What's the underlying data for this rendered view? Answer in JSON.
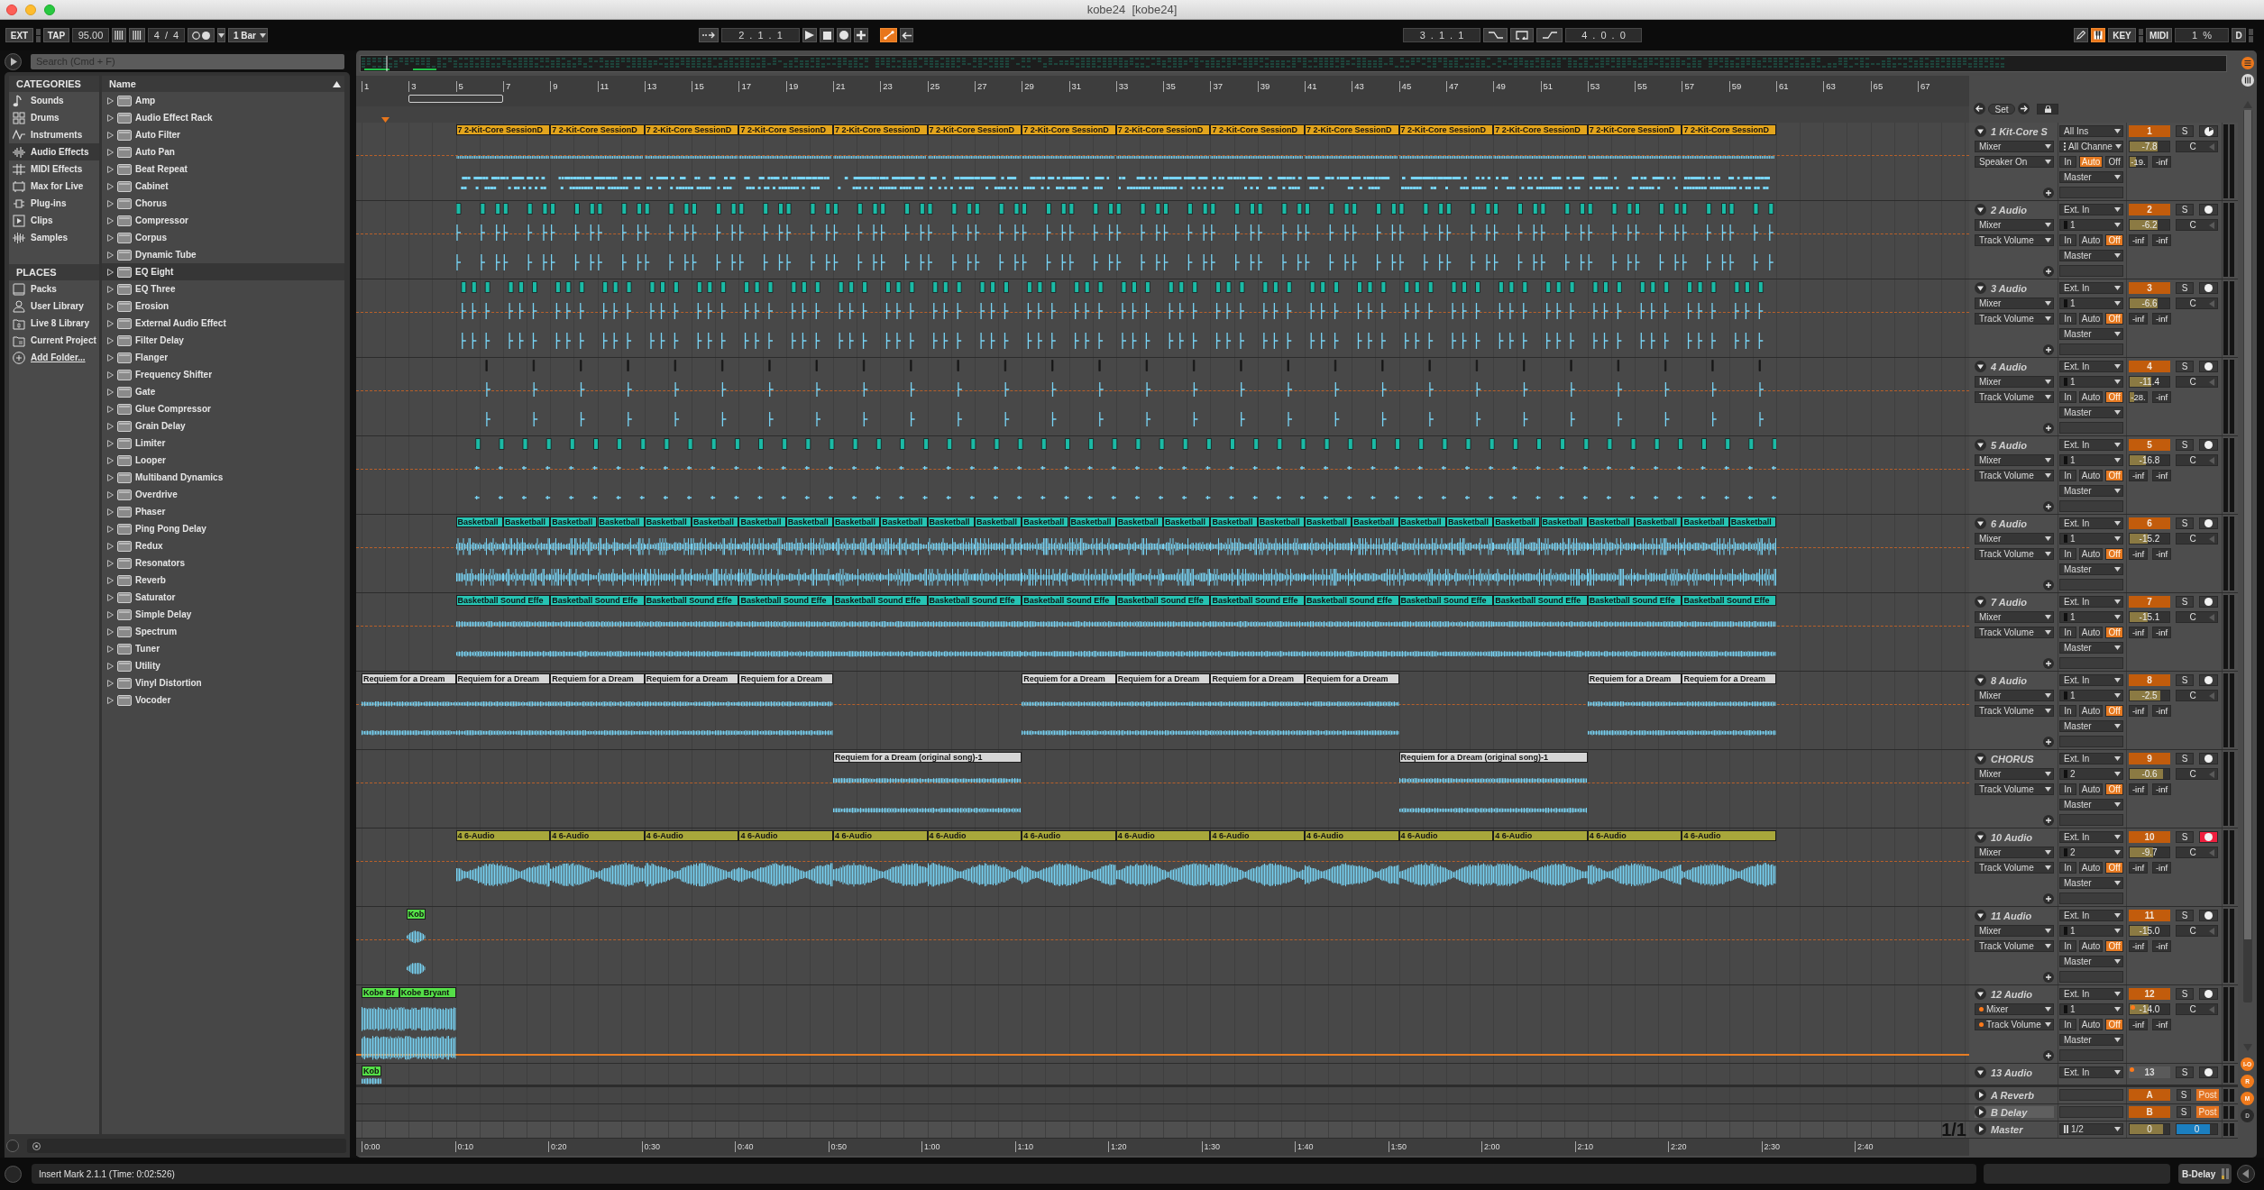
{
  "window": {
    "title": "kobe24  [kobe24]"
  },
  "control_bar": {
    "ext": "EXT",
    "tap": "TAP",
    "tempo": "95.00",
    "time_signature": "4 / 4",
    "metronome_on": false,
    "quantization": "1 Bar",
    "follow_on": false,
    "position": "2 . 1 . 1",
    "transport": [
      {
        "kind": "play",
        "on": false
      },
      {
        "kind": "stop",
        "on": false
      },
      {
        "kind": "record",
        "on": false
      },
      {
        "kind": "overdub",
        "on": false
      },
      {
        "kind": "automation_arm",
        "on": true
      },
      {
        "kind": "back_to_arrangement",
        "on": false
      }
    ],
    "loop_start": "3 . 1 . 1",
    "loop_switches": [
      {
        "kind": "punch_in",
        "on": false
      },
      {
        "kind": "loop",
        "on": false
      },
      {
        "kind": "punch_out",
        "on": false
      }
    ],
    "loop_length": "4 . 0 . 0",
    "draw_mode_on": false,
    "computer_keyboard_on": true,
    "key_map": "KEY",
    "midi_map": "MIDI",
    "cpu_load": "1 %",
    "disk_overload": "D"
  },
  "browser": {
    "search": {
      "placeholder": "Search (Cmd + F)"
    },
    "categories_heading": "CATEGORIES",
    "categories": [
      {
        "label": "Sounds",
        "selected": false
      },
      {
        "label": "Drums",
        "selected": false
      },
      {
        "label": "Instruments",
        "selected": false
      },
      {
        "label": "Audio Effects",
        "selected": true
      },
      {
        "label": "MIDI Effects",
        "selected": false
      },
      {
        "label": "Max for Live",
        "selected": false
      },
      {
        "label": "Plug-ins",
        "selected": false
      },
      {
        "label": "Clips",
        "selected": false
      },
      {
        "label": "Samples",
        "selected": false
      }
    ],
    "places_heading": "PLACES",
    "places": [
      {
        "label": "Packs",
        "selected": false
      },
      {
        "label": "User Library",
        "selected": false
      },
      {
        "label": "Live 8 Library",
        "selected": false
      },
      {
        "label": "Current Project",
        "selected": false
      }
    ],
    "add_folder": "Add Folder...",
    "name_column": "Name",
    "items": [
      {
        "label": "Amp",
        "expanded": false,
        "selected": false
      },
      {
        "label": "Audio Effect Rack",
        "expanded": false,
        "selected": false
      },
      {
        "label": "Auto Filter",
        "expanded": false,
        "selected": false
      },
      {
        "label": "Auto Pan",
        "expanded": false,
        "selected": false
      },
      {
        "label": "Beat Repeat",
        "expanded": false,
        "selected": false
      },
      {
        "label": "Cabinet",
        "expanded": false,
        "selected": false
      },
      {
        "label": "Chorus",
        "expanded": false,
        "selected": false
      },
      {
        "label": "Compressor",
        "expanded": false,
        "selected": false
      },
      {
        "label": "Corpus",
        "expanded": false,
        "selected": false
      },
      {
        "label": "Dynamic Tube",
        "expanded": false,
        "selected": false
      },
      {
        "label": "EQ Eight",
        "expanded": false,
        "selected": true
      },
      {
        "label": "EQ Three",
        "expanded": false,
        "selected": false
      },
      {
        "label": "Erosion",
        "expanded": false,
        "selected": false
      },
      {
        "label": "External Audio Effect",
        "expanded": false,
        "selected": false
      },
      {
        "label": "Filter Delay",
        "expanded": false,
        "selected": false
      },
      {
        "label": "Flanger",
        "expanded": false,
        "selected": false
      },
      {
        "label": "Frequency Shifter",
        "expanded": false,
        "selected": false
      },
      {
        "label": "Gate",
        "expanded": false,
        "selected": false
      },
      {
        "label": "Glue Compressor",
        "expanded": false,
        "selected": false
      },
      {
        "label": "Grain Delay",
        "expanded": false,
        "selected": false
      },
      {
        "label": "Limiter",
        "expanded": false,
        "selected": false
      },
      {
        "label": "Looper",
        "expanded": false,
        "selected": false
      },
      {
        "label": "Multiband Dynamics",
        "expanded": false,
        "selected": false
      },
      {
        "label": "Overdrive",
        "expanded": false,
        "selected": false
      },
      {
        "label": "Phaser",
        "expanded": false,
        "selected": false
      },
      {
        "label": "Ping Pong Delay",
        "expanded": false,
        "selected": false
      },
      {
        "label": "Redux",
        "expanded": false,
        "selected": false
      },
      {
        "label": "Resonators",
        "expanded": false,
        "selected": false
      },
      {
        "label": "Reverb",
        "expanded": false,
        "selected": false
      },
      {
        "label": "Saturator",
        "expanded": false,
        "selected": false
      },
      {
        "label": "Simple Delay",
        "expanded": false,
        "selected": false
      },
      {
        "label": "Spectrum",
        "expanded": false,
        "selected": false
      },
      {
        "label": "Tuner",
        "expanded": false,
        "selected": false
      },
      {
        "label": "Utility",
        "expanded": false,
        "selected": false
      },
      {
        "label": "Vinyl Distortion",
        "expanded": false,
        "selected": false
      },
      {
        "label": "Vocoder",
        "expanded": false,
        "selected": false
      }
    ]
  },
  "arrangement": {
    "bar_ruler": [
      "1",
      "3",
      "5",
      "7",
      "9",
      "11",
      "13",
      "15",
      "17",
      "19",
      "21",
      "23",
      "25",
      "27",
      "29",
      "31",
      "33",
      "35",
      "37",
      "39",
      "41",
      "43",
      "45",
      "47",
      "49",
      "51",
      "53",
      "55",
      "57",
      "59",
      "61",
      "63",
      "65",
      "67"
    ],
    "locators": {
      "set": "Set"
    },
    "tracks": [
      {
        "name": "1 Kit-Core S",
        "kind": "midi",
        "expanded": true,
        "selected": false,
        "color": "#e3a51d",
        "clips": [
          {
            "name": "7 2-Kit-Core SessionD"
          },
          {
            "name": "7 2-Kit-Core SessionD"
          },
          {
            "name": "7 2-Kit-Core SessionD"
          },
          {
            "name": "7 2-Kit-Core SessionD"
          },
          {
            "name": "7 2-Kit-Core SessionD"
          },
          {
            "name": "7 2-Kit-Core SessionD"
          },
          {
            "name": "7 2-Kit-Core SessionD"
          },
          {
            "name": "7 2-Kit-Core SessionD"
          },
          {
            "name": "7 2-Kit-Core SessionD"
          },
          {
            "name": "7 2-Kit-Core SessionD"
          },
          {
            "name": "7 2-Kit-Core SessionD"
          },
          {
            "name": "7 2-Kit-Core SessionD"
          },
          {
            "name": "7 2-Kit-Core SessionD"
          },
          {
            "name": "7 2-Kit-Core SessionD"
          }
        ],
        "device_chooser": "Mixer",
        "control_chooser": "Speaker On",
        "automation": false,
        "input_type": "All Ins",
        "input_channel": "All Channe",
        "monitor": [
          {
            "label": "In",
            "selected": false
          },
          {
            "label": "Auto",
            "selected": true
          },
          {
            "label": "Off",
            "selected": false
          }
        ],
        "output": "Master",
        "number": "1",
        "active": true,
        "solo": "S",
        "armed": false,
        "volume": {
          "reading": "-7.8",
          "level": 0.7
        },
        "pan": "C",
        "peak": [
          {
            "reading": "-19.",
            "level": 0.35
          },
          {
            "reading": "-inf"
          }
        ]
      },
      {
        "name": "2 Audio",
        "kind": "audio",
        "expanded": true,
        "selected": false,
        "color": "#1bbba6",
        "device_chooser": "Mixer",
        "control_chooser": "Track Volume",
        "automation": false,
        "input_type": "Ext. In",
        "input_channel": "1",
        "monitor": [
          {
            "label": "In",
            "selected": false
          },
          {
            "label": "Auto",
            "selected": false
          },
          {
            "label": "Off",
            "selected": true
          }
        ],
        "output": "Master",
        "number": "2",
        "active": true,
        "solo": "S",
        "armed": false,
        "volume": {
          "reading": "-6.2",
          "level": 0.7
        },
        "pan": "C",
        "peak": [
          {
            "reading": "-inf"
          },
          {
            "reading": "-inf"
          }
        ]
      },
      {
        "name": "3 Audio",
        "kind": "audio",
        "expanded": true,
        "selected": false,
        "color": "#1bbba6",
        "device_chooser": "Mixer",
        "control_chooser": "Track Volume",
        "automation": false,
        "input_type": "Ext. In",
        "input_channel": "1",
        "monitor": [
          {
            "label": "In",
            "selected": false
          },
          {
            "label": "Auto",
            "selected": false
          },
          {
            "label": "Off",
            "selected": true
          }
        ],
        "output": "Master",
        "number": "3",
        "active": true,
        "solo": "S",
        "armed": false,
        "volume": {
          "reading": "-6.6",
          "level": 0.7
        },
        "pan": "C",
        "peak": [
          {
            "reading": "-inf"
          },
          {
            "reading": "-inf"
          }
        ]
      },
      {
        "name": "4 Audio",
        "kind": "audio",
        "expanded": true,
        "selected": false,
        "device_chooser": "Mixer",
        "control_chooser": "Track Volume",
        "automation": false,
        "input_type": "Ext. In",
        "input_channel": "1",
        "monitor": [
          {
            "label": "In",
            "selected": false
          },
          {
            "label": "Auto",
            "selected": false
          },
          {
            "label": "Off",
            "selected": true
          }
        ],
        "output": "Master",
        "number": "4",
        "active": true,
        "solo": "S",
        "armed": false,
        "volume": {
          "reading": "-11.4",
          "level": 0.55
        },
        "pan": "C",
        "peak": [
          {
            "reading": "-28.",
            "level": 0.25
          },
          {
            "reading": "-inf"
          }
        ]
      },
      {
        "name": "5 Audio",
        "kind": "audio",
        "expanded": true,
        "selected": false,
        "color": "#1bbba6",
        "device_chooser": "Mixer",
        "control_chooser": "Track Volume",
        "automation": false,
        "input_type": "Ext. In",
        "input_channel": "1",
        "monitor": [
          {
            "label": "In",
            "selected": false
          },
          {
            "label": "Auto",
            "selected": false
          },
          {
            "label": "Off",
            "selected": true
          }
        ],
        "output": "Master",
        "number": "5",
        "active": true,
        "solo": "S",
        "armed": false,
        "volume": {
          "reading": "-16.8",
          "level": 0.42
        },
        "pan": "C",
        "peak": [
          {
            "reading": "-inf"
          },
          {
            "reading": "-inf"
          }
        ]
      },
      {
        "name": "6 Audio",
        "kind": "audio",
        "expanded": true,
        "selected": false,
        "color": "#26c4b3",
        "clips": [
          {
            "name": "Basketball"
          },
          {
            "name": "Basketball"
          },
          {
            "name": "Basketball"
          },
          {
            "name": "Basketball"
          },
          {
            "name": "Basketball"
          },
          {
            "name": "Basketball"
          },
          {
            "name": "Basketball"
          },
          {
            "name": "Basketball"
          },
          {
            "name": "Basketball"
          },
          {
            "name": "Basketball"
          },
          {
            "name": "Basketball"
          },
          {
            "name": "Basketball"
          },
          {
            "name": "Basketball"
          },
          {
            "name": "Basketball"
          },
          {
            "name": "Basketball"
          },
          {
            "name": "Basketball"
          },
          {
            "name": "Basketball"
          },
          {
            "name": "Basketball"
          },
          {
            "name": "Basketball"
          },
          {
            "name": "Basketball"
          },
          {
            "name": "Basketball"
          },
          {
            "name": "Basketball"
          },
          {
            "name": "Basketball"
          },
          {
            "name": "Basketball"
          },
          {
            "name": "Basketball"
          },
          {
            "name": "Basketball"
          },
          {
            "name": "Basketball"
          },
          {
            "name": "Basketball"
          }
        ],
        "device_chooser": "Mixer",
        "control_chooser": "Track Volume",
        "automation": false,
        "input_type": "Ext. In",
        "input_channel": "1",
        "monitor": [
          {
            "label": "In",
            "selected": false
          },
          {
            "label": "Auto",
            "selected": false
          },
          {
            "label": "Off",
            "selected": true
          }
        ],
        "output": "Master",
        "number": "6",
        "active": true,
        "solo": "S",
        "armed": false,
        "volume": {
          "reading": "-15.2",
          "level": 0.45
        },
        "pan": "C",
        "peak": [
          {
            "reading": "-inf"
          },
          {
            "reading": "-inf"
          }
        ]
      },
      {
        "name": "7 Audio",
        "kind": "audio",
        "expanded": true,
        "selected": false,
        "color": "#26c4b3",
        "clips": [
          {
            "name": "Basketball Sound Effe"
          },
          {
            "name": "Basketball Sound Effe"
          },
          {
            "name": "Basketball Sound Effe"
          },
          {
            "name": "Basketball Sound Effe"
          },
          {
            "name": "Basketball Sound Effe"
          },
          {
            "name": "Basketball Sound Effe"
          },
          {
            "name": "Basketball Sound Effe"
          },
          {
            "name": "Basketball Sound Effe"
          },
          {
            "name": "Basketball Sound Effe"
          },
          {
            "name": "Basketball Sound Effe"
          },
          {
            "name": "Basketball Sound Effe"
          },
          {
            "name": "Basketball Sound Effe"
          },
          {
            "name": "Basketball Sound Effe"
          },
          {
            "name": "Basketball Sound Effe"
          }
        ],
        "device_chooser": "Mixer",
        "control_chooser": "Track Volume",
        "automation": false,
        "input_type": "Ext. In",
        "input_channel": "1",
        "monitor": [
          {
            "label": "In",
            "selected": false
          },
          {
            "label": "Auto",
            "selected": false
          },
          {
            "label": "Off",
            "selected": true
          }
        ],
        "output": "Master",
        "number": "7",
        "active": true,
        "solo": "S",
        "armed": false,
        "volume": {
          "reading": "-15.1",
          "level": 0.45
        },
        "pan": "C",
        "peak": [
          {
            "reading": "-inf"
          },
          {
            "reading": "-inf"
          }
        ]
      },
      {
        "name": "8 Audio",
        "kind": "audio",
        "expanded": true,
        "selected": false,
        "color": "#d6d6d6",
        "clips": [
          {
            "name": "Requiem for a Dream"
          },
          {
            "name": "Requiem for a Dream"
          },
          {
            "name": "Requiem for a Dream"
          },
          {
            "name": "Requiem for a Dream"
          },
          {
            "name": "Requiem for a Dream"
          },
          {
            "name": "Requiem for a Dream"
          },
          {
            "name": "Requiem for a Dream"
          },
          {
            "name": "Requiem for a Dream"
          },
          {
            "name": "Requiem for a Dream"
          },
          {
            "name": "Requiem for a Dream"
          },
          {
            "name": "Requiem for a Dream"
          }
        ],
        "device_chooser": "Mixer",
        "control_chooser": "Track Volume",
        "automation": false,
        "input_type": "Ext. In",
        "input_channel": "1",
        "monitor": [
          {
            "label": "In",
            "selected": false
          },
          {
            "label": "Auto",
            "selected": false
          },
          {
            "label": "Off",
            "selected": true
          }
        ],
        "output": "Master",
        "number": "8",
        "active": true,
        "solo": "S",
        "armed": false,
        "volume": {
          "reading": "-2.5",
          "level": 0.77
        },
        "pan": "C",
        "peak": [
          {
            "reading": "-inf"
          },
          {
            "reading": "-inf"
          }
        ]
      },
      {
        "name": "CHORUS",
        "kind": "audio",
        "expanded": true,
        "selected": false,
        "color": "#d6d6d6",
        "clips": [
          {
            "name": "Requiem for a Dream (original song)-1"
          },
          {
            "name": "Requiem for a Dream (original song)-1"
          }
        ],
        "device_chooser": "Mixer",
        "control_chooser": "Track Volume",
        "automation": false,
        "input_type": "Ext. In",
        "input_channel": "2",
        "monitor": [
          {
            "label": "In",
            "selected": false
          },
          {
            "label": "Auto",
            "selected": false
          },
          {
            "label": "Off",
            "selected": true
          }
        ],
        "output": "Master",
        "number": "9",
        "active": true,
        "solo": "S",
        "armed": false,
        "volume": {
          "reading": "-0.6",
          "level": 0.83
        },
        "pan": "C",
        "peak": [
          {
            "reading": "-inf"
          },
          {
            "reading": "-inf"
          }
        ]
      },
      {
        "name": "10 Audio",
        "kind": "audio",
        "expanded": true,
        "selected": false,
        "color": "#a8a73b",
        "clips": [
          {
            "name": "4 6-Audio"
          },
          {
            "name": "4 6-Audio"
          },
          {
            "name": "4 6-Audio"
          },
          {
            "name": "4 6-Audio"
          },
          {
            "name": "4 6-Audio"
          },
          {
            "name": "4 6-Audio"
          },
          {
            "name": "4 6-Audio"
          },
          {
            "name": "4 6-Audio"
          },
          {
            "name": "4 6-Audio"
          },
          {
            "name": "4 6-Audio"
          },
          {
            "name": "4 6-Audio"
          },
          {
            "name": "4 6-Audio"
          },
          {
            "name": "4 6-Audio"
          },
          {
            "name": "4 6-Audio"
          }
        ],
        "device_chooser": "Mixer",
        "control_chooser": "Track Volume",
        "automation": false,
        "input_type": "Ext. In",
        "input_channel": "2",
        "monitor": [
          {
            "label": "In",
            "selected": false
          },
          {
            "label": "Auto",
            "selected": false
          },
          {
            "label": "Off",
            "selected": true
          }
        ],
        "output": "Master",
        "number": "10",
        "active": true,
        "solo": "S",
        "armed": true,
        "volume": {
          "reading": "-9.7",
          "level": 0.6
        },
        "pan": "C",
        "peak": [
          {
            "reading": "-inf"
          },
          {
            "reading": "-inf"
          }
        ]
      },
      {
        "name": "11 Audio",
        "kind": "audio",
        "expanded": true,
        "selected": false,
        "color": "#55df48",
        "clips": [
          {
            "name": "Kob"
          }
        ],
        "device_chooser": "Mixer",
        "control_chooser": "Track Volume",
        "automation": false,
        "input_type": "Ext. In",
        "input_channel": "1",
        "monitor": [
          {
            "label": "In",
            "selected": false
          },
          {
            "label": "Auto",
            "selected": false
          },
          {
            "label": "Off",
            "selected": true
          }
        ],
        "output": "Master",
        "number": "11",
        "active": true,
        "solo": "S",
        "armed": false,
        "volume": {
          "reading": "-15.0",
          "level": 0.48
        },
        "pan": "C",
        "peak": [
          {
            "reading": "-inf"
          },
          {
            "reading": "-inf"
          }
        ]
      },
      {
        "name": "12 Audio",
        "kind": "audio",
        "expanded": true,
        "selected": false,
        "color": "#55df48",
        "clips": [
          {
            "name": "Kobe Br"
          },
          {
            "name": "Kobe Bryant"
          }
        ],
        "device_chooser": "Mixer",
        "control_chooser": "Track Volume",
        "automation": true,
        "input_type": "Ext. In",
        "input_channel": "1",
        "monitor": [
          {
            "label": "In",
            "selected": false
          },
          {
            "label": "Auto",
            "selected": false
          },
          {
            "label": "Off",
            "selected": true
          }
        ],
        "output": "Master",
        "number": "12",
        "active": true,
        "solo": "S",
        "armed": false,
        "volume": {
          "reading": "-14.0",
          "level": 0.48
        },
        "pan": "C",
        "peak": [
          {
            "reading": "-inf"
          },
          {
            "reading": "-inf"
          }
        ]
      },
      {
        "name": "13 Audio",
        "kind": "audio",
        "expanded": true,
        "selected": false,
        "color": "#55df48",
        "clips": [
          {
            "name": "Kob"
          }
        ],
        "automation": true,
        "input_type": "Ext. In",
        "number": "13",
        "active": false,
        "solo": "S",
        "armed": false
      }
    ],
    "returns": [
      {
        "name": "A Reverb",
        "expanded": false,
        "selected": false,
        "letter": "A",
        "active": true,
        "solo": "S",
        "send_mode": "Post",
        "post": true
      },
      {
        "name": "B Delay",
        "expanded": false,
        "selected": true,
        "letter": "B",
        "active": true,
        "solo": "S",
        "send_mode": "Post",
        "post": true
      }
    ],
    "master": {
      "name": "Master",
      "expanded": false,
      "selected": false,
      "output": "1/2",
      "volume": {
        "reading": "0",
        "level": 0.83
      },
      "cue": {
        "reading": "0",
        "level": 0.83
      }
    },
    "page_indicator": "1/1",
    "time_ruler": [
      "0:00",
      "0:10",
      "0:20",
      "0:30",
      "0:40",
      "0:50",
      "1:00",
      "1:10",
      "1:20",
      "1:30",
      "1:40",
      "1:50",
      "2:00",
      "2:10",
      "2:20",
      "2:30",
      "2:40"
    ]
  },
  "view_toggles": [
    {
      "label": "I-O",
      "on": true
    },
    {
      "label": "R",
      "on": true
    },
    {
      "label": "M",
      "on": true
    },
    {
      "label": "D",
      "on": false
    }
  ],
  "status_bar": {
    "message": "Insert Mark 2.1.1 (Time: 0:02:526)",
    "selected_device": "B-Delay"
  }
}
